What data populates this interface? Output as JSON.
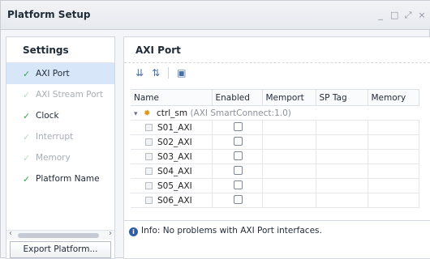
{
  "window": {
    "title": "Platform Setup",
    "controls": [
      "_",
      "□",
      "⤢",
      "×"
    ]
  },
  "settings": {
    "header": "Settings",
    "items": [
      {
        "label": "AXI Port",
        "state": "active"
      },
      {
        "label": "AXI Stream Port",
        "state": "faded"
      },
      {
        "label": "Clock",
        "state": "done"
      },
      {
        "label": "Interrupt",
        "state": "faded"
      },
      {
        "label": "Memory",
        "state": "faded"
      },
      {
        "label": "Platform Name",
        "state": "done"
      }
    ],
    "scroll_left": "‹",
    "scroll_right": "›",
    "export_button": "Export Platform..."
  },
  "main": {
    "header": "AXI Port",
    "columns": [
      "Name",
      "Enabled",
      "Memport",
      "SP Tag",
      "Memory"
    ],
    "group": {
      "name": "ctrl_sm",
      "detail": "(AXI SmartConnect:1.0)"
    },
    "ports": [
      {
        "name": "S01_AXI",
        "enabled": false
      },
      {
        "name": "S02_AXI",
        "enabled": false
      },
      {
        "name": "S03_AXI",
        "enabled": false
      },
      {
        "name": "S04_AXI",
        "enabled": false
      },
      {
        "name": "S05_AXI",
        "enabled": false
      },
      {
        "name": "S06_AXI",
        "enabled": false
      }
    ],
    "info_message": "Info: No problems with AXI Port interfaces."
  },
  "colors": {
    "accent": "#d7e6f8",
    "check_green": "#34a853",
    "info_blue": "#2e5da8"
  }
}
